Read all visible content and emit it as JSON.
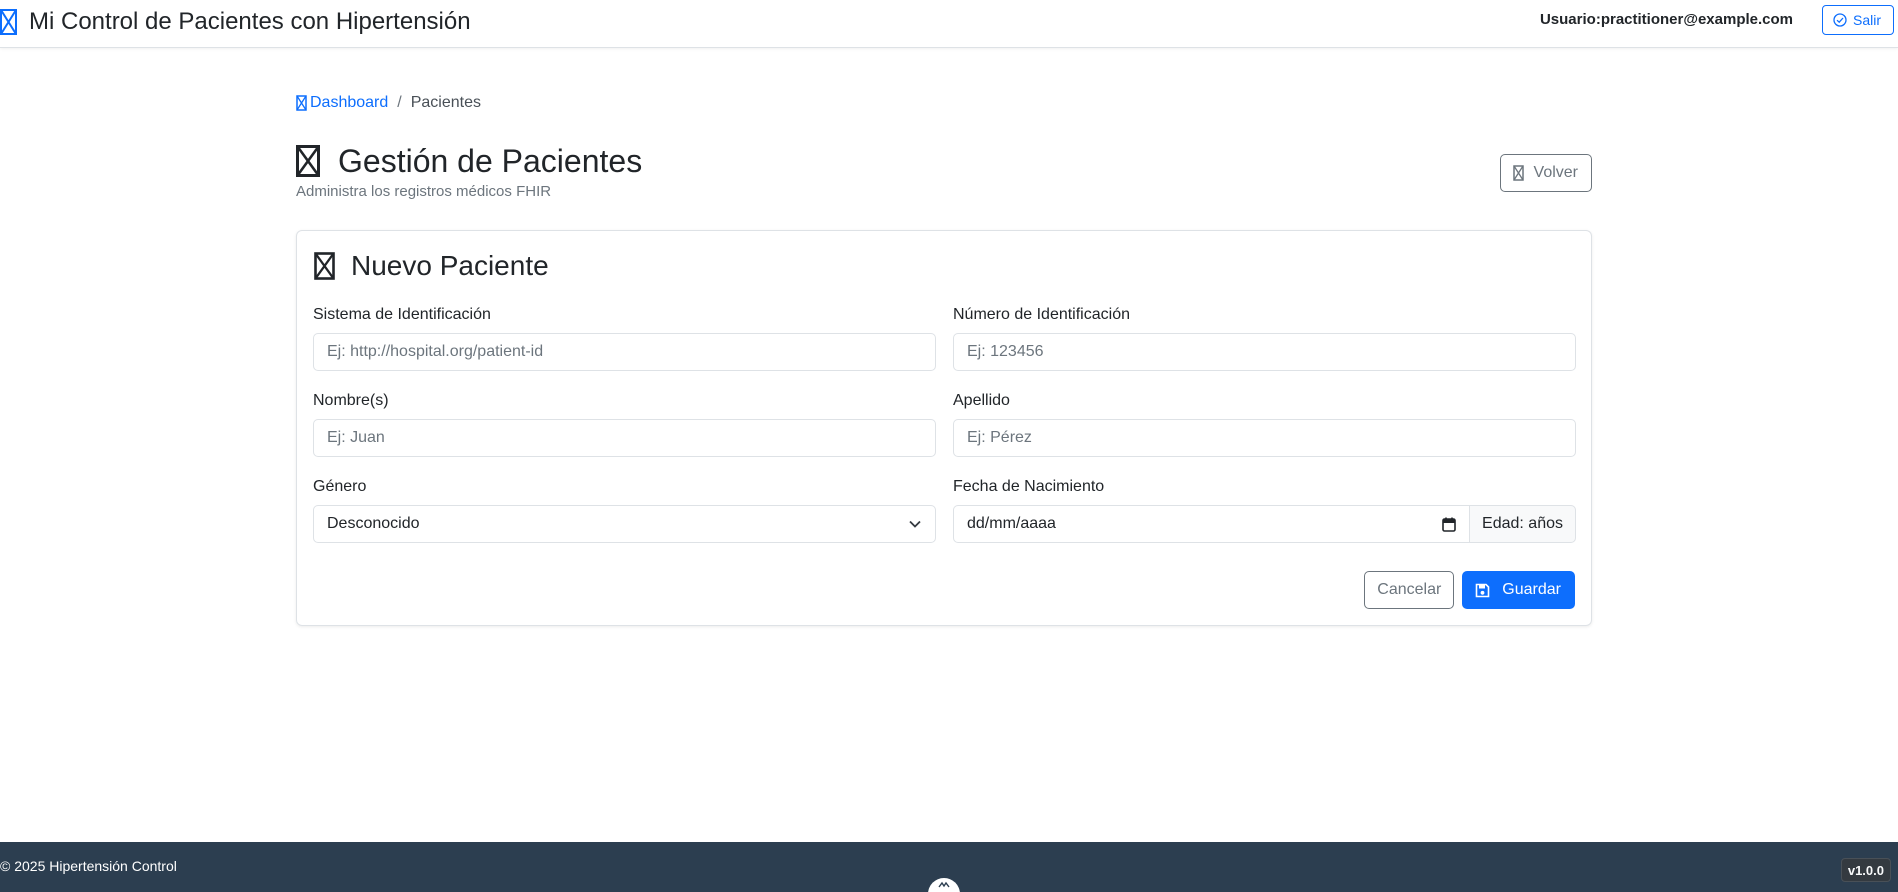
{
  "navbar": {
    "brand_icon": "heart-pulse-icon",
    "title": "Mi Control de Pacientes con Hipertensión",
    "user_label": "Usuario:",
    "user_email": "practitioner@example.com",
    "logout_label": "Salir",
    "logout_icon": "check-circle-icon"
  },
  "breadcrumb": {
    "home_icon": "dashboard-icon",
    "home_label": "Dashboard",
    "separator": "/",
    "current": "Pacientes"
  },
  "page": {
    "title_icon": "users-icon",
    "title": "Gestión de Pacientes",
    "subtitle": "Administra los registros médicos FHIR",
    "back_icon": "arrow-left-icon",
    "back_label": "Volver"
  },
  "form": {
    "title_icon": "user-plus-icon",
    "title": "Nuevo Paciente",
    "fields": {
      "id_system": {
        "label": "Sistema de Identificación",
        "placeholder": "Ej: http://hospital.org/patient-id"
      },
      "id_number": {
        "label": "Número de Identificación",
        "placeholder": "Ej: 123456"
      },
      "given_name": {
        "label": "Nombre(s)",
        "placeholder": "Ej: Juan"
      },
      "family_name": {
        "label": "Apellido",
        "placeholder": "Ej: Pérez"
      },
      "gender": {
        "label": "Género",
        "value": "Desconocido"
      },
      "birth_date": {
        "label": "Fecha de Nacimiento",
        "value": "dd/mm/aaaa",
        "age_addon": "Edad: años"
      }
    },
    "cancel_label": "Cancelar",
    "save_label": "Guardar",
    "save_icon": "save-icon"
  },
  "footer": {
    "copyright": "© 2025 Hipertensión Control",
    "version": "v1.0.0"
  },
  "colors": {
    "primary": "#0d6efd",
    "secondary": "#6c757d",
    "footer_bg": "#2c3e50"
  }
}
